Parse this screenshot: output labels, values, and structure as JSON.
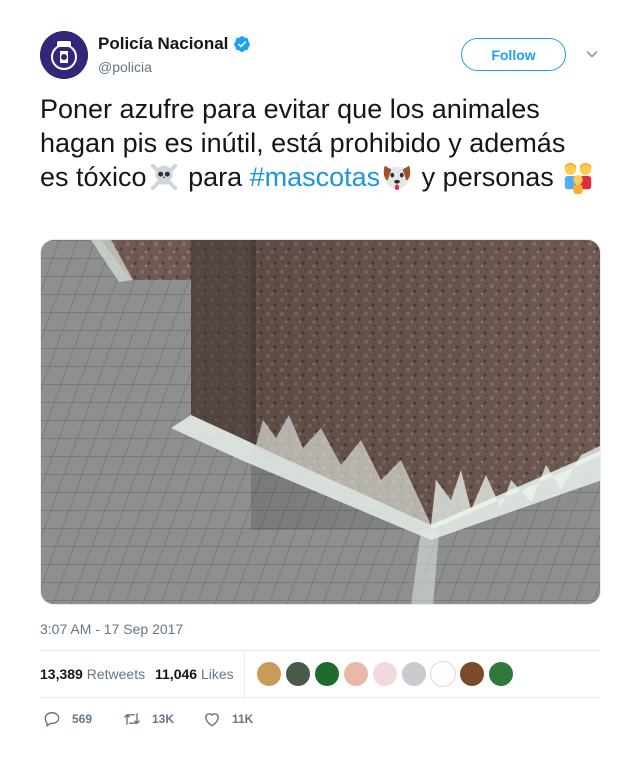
{
  "account": {
    "name": "Policía Nacional",
    "handle": "@policia",
    "verified_icon": "verified-badge-icon",
    "follow_label": "Follow"
  },
  "tweet": {
    "text_part1": "Poner azufre para evitar que los animales hagan pis es inútil, está prohibido y además es tóxico",
    "text_part2": " para ",
    "hashtag": "#mascotas",
    "text_part3": " y personas",
    "emojis": [
      "skull-crossbones-icon",
      "dog-face-icon",
      "family-icon"
    ]
  },
  "timestamp": "3:07 AM - 17 Sep 2017",
  "stats": {
    "retweets_count": "13,389",
    "retweets_label": "Retweets",
    "likes_count": "11,046",
    "likes_label": "Likes",
    "liker_avatar_count": 9
  },
  "actions": {
    "reply_count": "569",
    "retweet_count": "13K",
    "like_count": "11K"
  },
  "colors": {
    "accent": "#1da1f2",
    "hashtag": "#1b95e0",
    "muted": "#657786"
  }
}
